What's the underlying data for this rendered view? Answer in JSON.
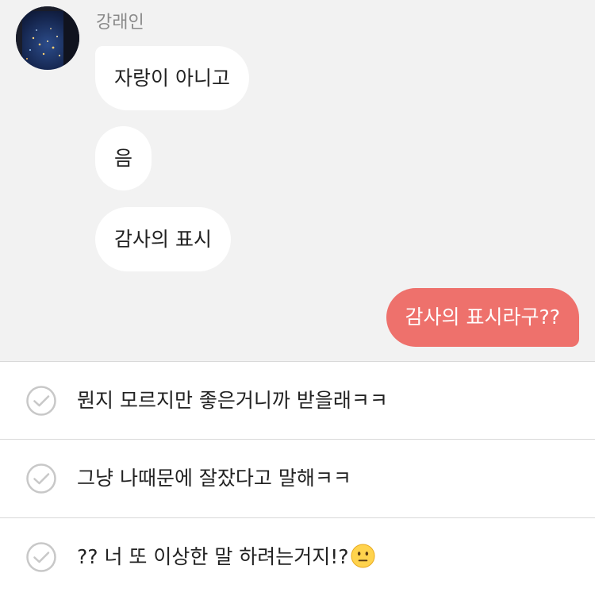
{
  "chat": {
    "sender_name": "강래인",
    "incoming_messages": [
      "자랑이 아니고",
      "음",
      "감사의 표시"
    ],
    "outgoing_message": "감사의 표시라구??"
  },
  "suggestions": [
    {
      "text": "뭔지 모르지만 좋은거니까 받을래ㅋㅋ"
    },
    {
      "text": "그냥 나때문에 잘잤다고 말해ㅋㅋ"
    },
    {
      "text": "?? 너 또 이상한 말 하려는거지!?",
      "emoji": "neutral-face-emoji"
    }
  ],
  "icons": {
    "avatar": "night-city-window-photo",
    "check": "check-circle-icon"
  },
  "colors": {
    "chat_background": "#f2f2f2",
    "incoming_bubble": "#ffffff",
    "outgoing_bubble": "#ee716c",
    "check_icon": "#c8c8c8"
  }
}
